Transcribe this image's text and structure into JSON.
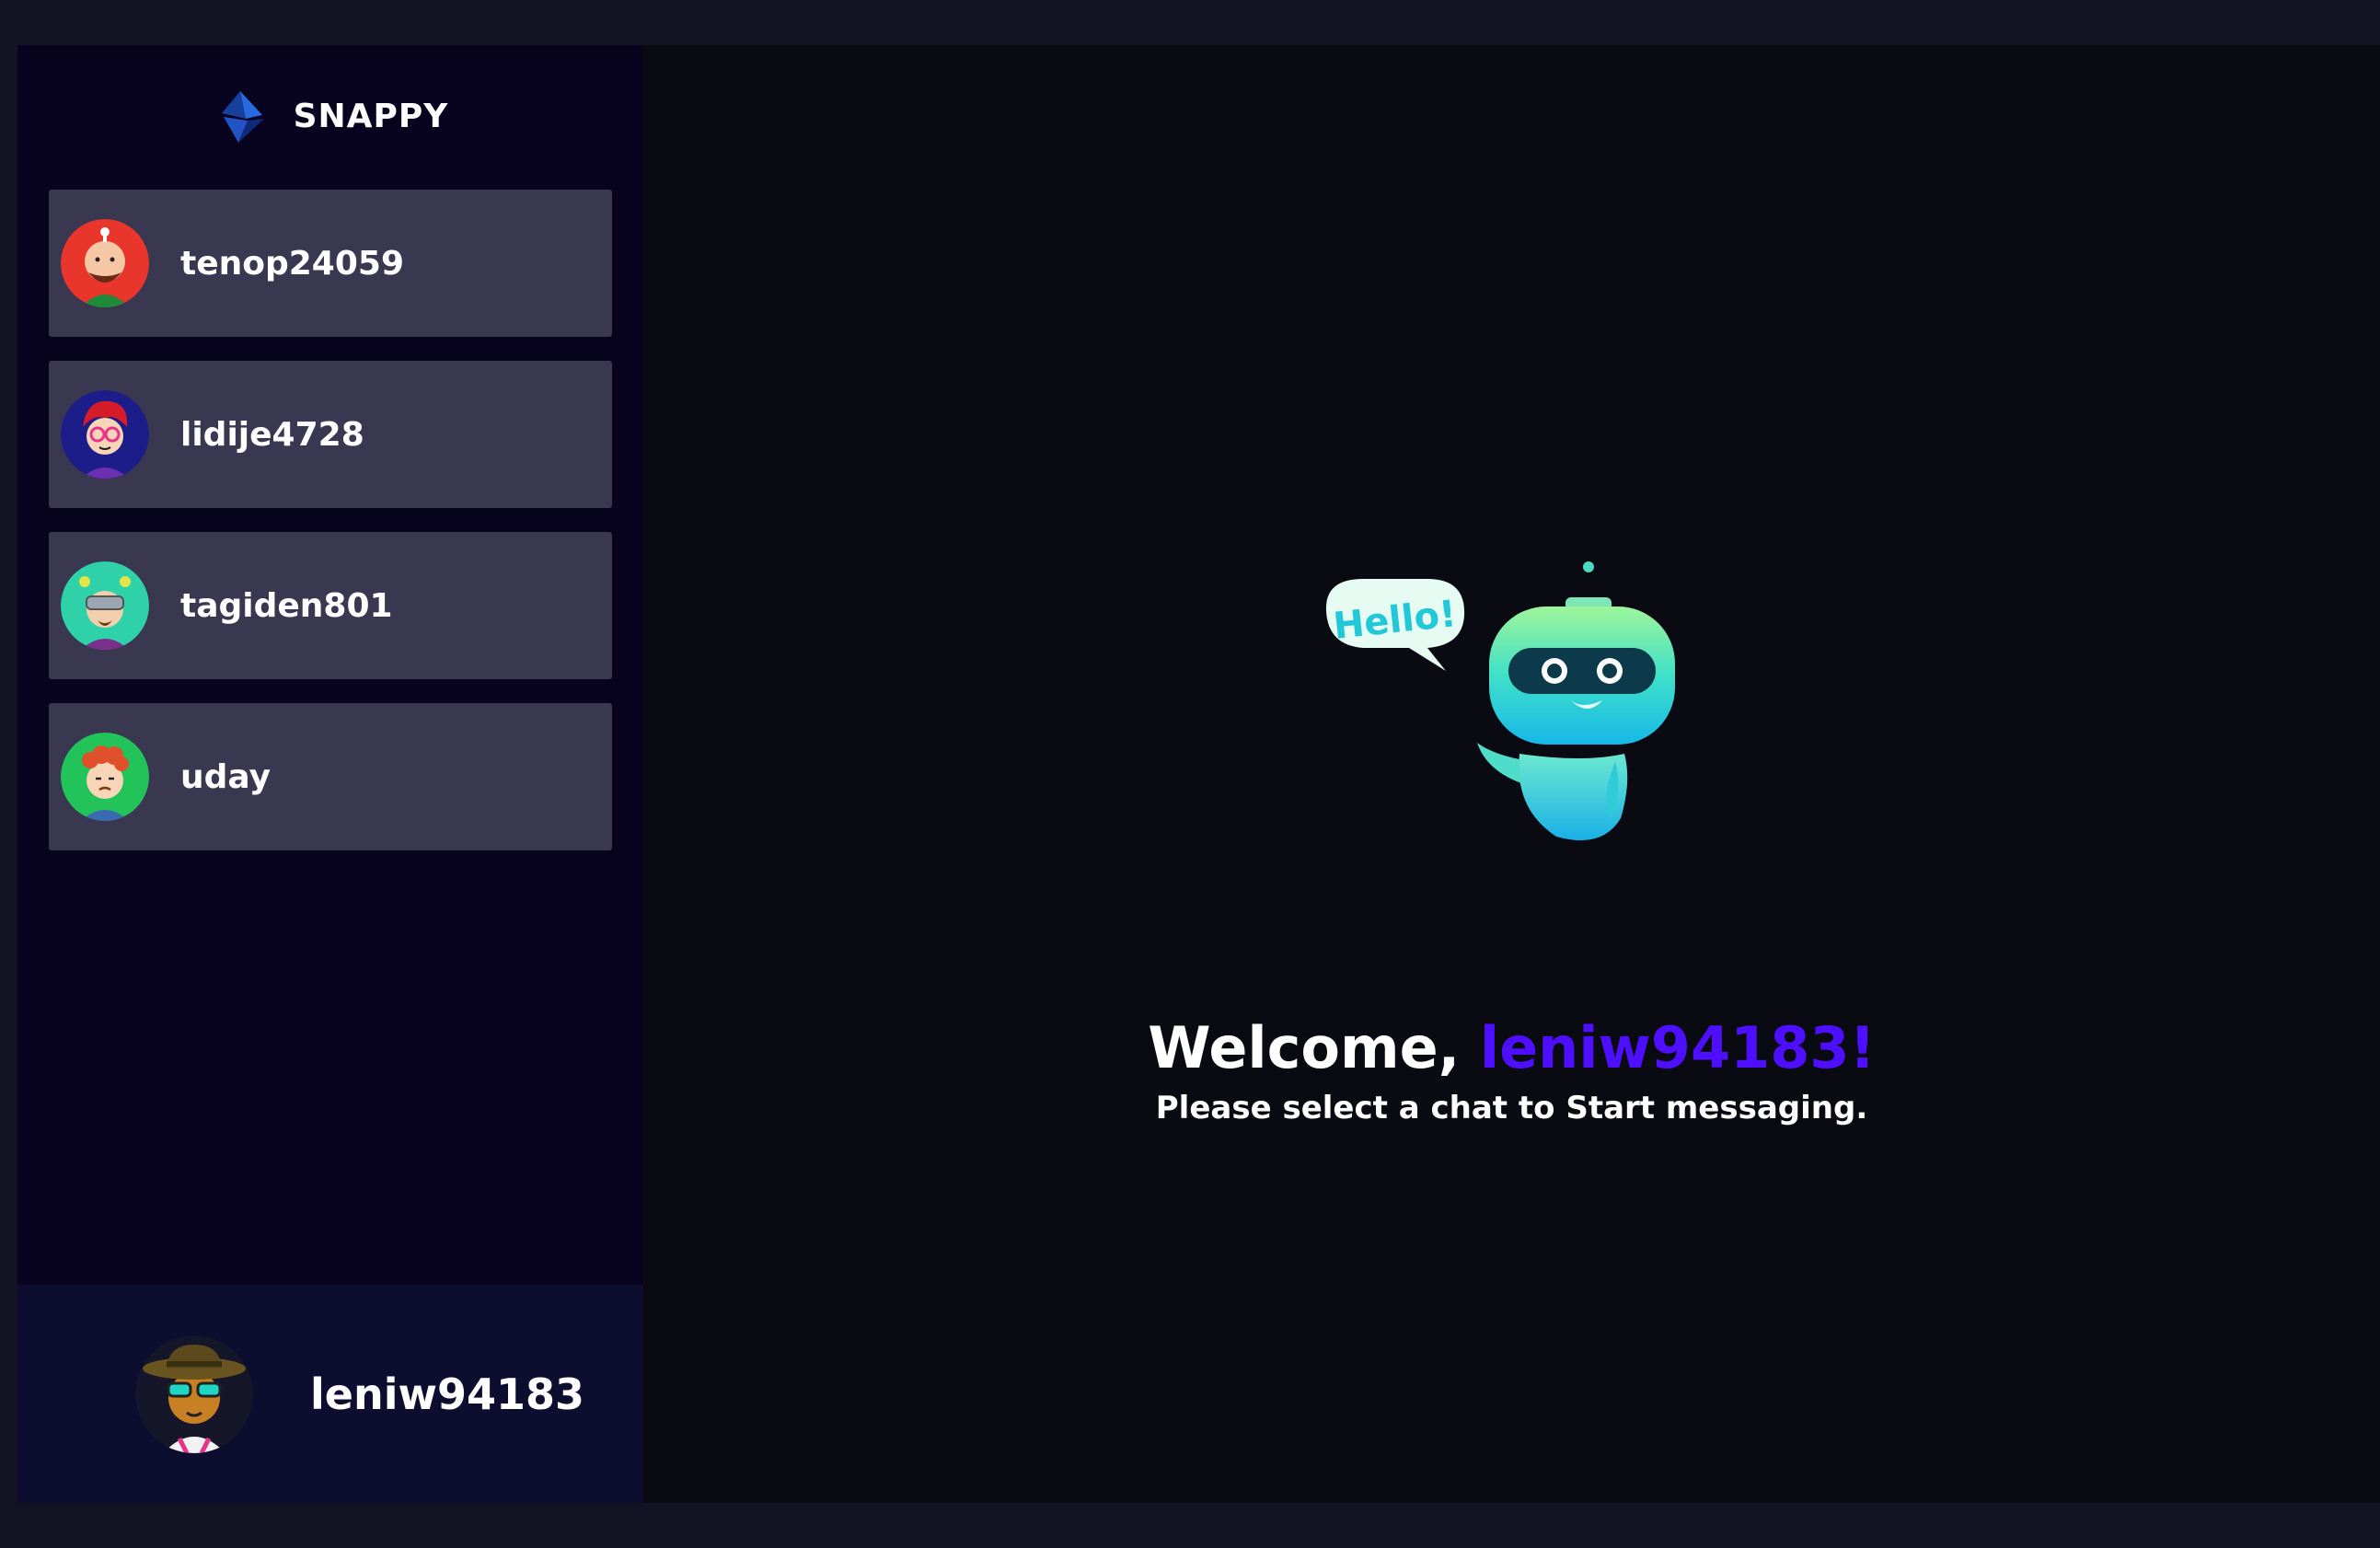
{
  "brand": {
    "name": "SNAPPY",
    "logo_icon": "snappy-logo-icon"
  },
  "contacts": [
    {
      "name": "tenop24059",
      "avatar": "avatar-red-bald-man"
    },
    {
      "name": "lidije4728",
      "avatar": "avatar-red-hair-glasses"
    },
    {
      "name": "tagiden801",
      "avatar": "avatar-teal-goggles"
    },
    {
      "name": "uday",
      "avatar": "avatar-curly-redhead"
    }
  ],
  "current_user": {
    "name": "leniw94183",
    "avatar": "avatar-hat-sunglasses"
  },
  "welcome": {
    "greeting": "Welcome, ",
    "username": "leniw94183!",
    "subtitle": "Please select a chat to Start messaging.",
    "bubble_text": "Hello!"
  },
  "colors": {
    "background": "#131324",
    "sidebar": "#080420",
    "contact_card": "#3a3750",
    "current_user_bar": "#0d0d30",
    "accent": "#4e0eff"
  }
}
